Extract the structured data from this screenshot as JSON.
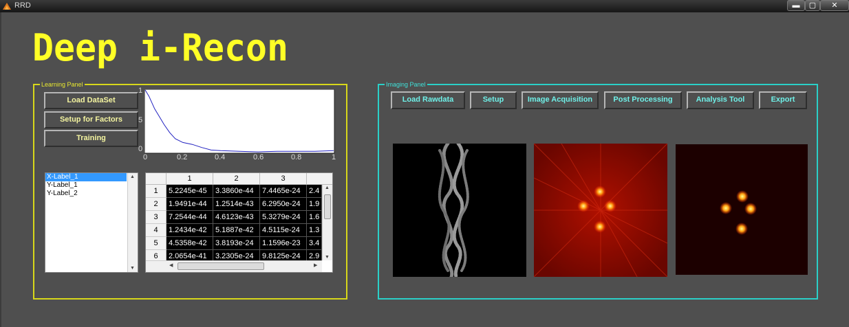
{
  "window": {
    "title": "RRD",
    "controls": [
      "▬",
      "▢",
      "✕"
    ]
  },
  "app_title": "Deep i-Recon",
  "colors": {
    "title_yellow": "#ffff26",
    "learning_border": "#d8d81a",
    "imaging_border": "#2ad0c8",
    "background": "#4f4f4f",
    "plot_line": "#2020c0"
  },
  "learning_panel": {
    "legend": "Learning Panel",
    "buttons": {
      "load_dataset": "Load DataSet",
      "setup_factors": "Setup for Factors",
      "training": "Training"
    },
    "plot": {
      "xticks": [
        "0",
        "0.2",
        "0.4",
        "0.6",
        "0.8",
        "1"
      ],
      "yticks": [
        "0",
        "5",
        "1"
      ],
      "xlim": [
        0,
        1
      ],
      "ylim": [
        0,
        1
      ],
      "series": [
        {
          "x": [
            0,
            0.02,
            0.05,
            0.08,
            0.1,
            0.13,
            0.16,
            0.2,
            0.25,
            0.3,
            0.35,
            0.4,
            0.5,
            0.6,
            0.7,
            0.8,
            0.9,
            1
          ],
          "y": [
            1,
            0.9,
            0.7,
            0.55,
            0.45,
            0.32,
            0.22,
            0.16,
            0.13,
            0.08,
            0.04,
            0.03,
            0.02,
            0.01,
            0.02,
            0.02,
            0.02,
            0.03
          ]
        }
      ]
    },
    "listbox": {
      "items": [
        "X-Label_1",
        "Y-Label_1",
        "Y-Label_2"
      ],
      "selected": 0
    },
    "table": {
      "columns": [
        "1",
        "2",
        "3"
      ],
      "rows": [
        {
          "label": "1",
          "cells": [
            "5.2245e-45",
            "3.3860e-44",
            "7.4465e-24",
            "2.4"
          ]
        },
        {
          "label": "2",
          "cells": [
            "1.9491e-44",
            "1.2514e-43",
            "6.2950e-24",
            "1.9"
          ]
        },
        {
          "label": "3",
          "cells": [
            "7.2544e-44",
            "4.6123e-43",
            "5.3279e-24",
            "1.6"
          ]
        },
        {
          "label": "4",
          "cells": [
            "1.2434e-42",
            "5.1887e-42",
            "4.5115e-24",
            "1.3"
          ]
        },
        {
          "label": "5",
          "cells": [
            "4.5358e-42",
            "3.8193e-24",
            "1.1596e-23",
            "3.4"
          ]
        },
        {
          "label": "6",
          "cells": [
            "2.0654e-41",
            "3.2305e-24",
            "9.8125e-24",
            "2.9"
          ]
        }
      ]
    }
  },
  "imaging_panel": {
    "legend": "Imaging Panel",
    "buttons": {
      "load_rawdata": "Load Rawdata",
      "setup": "Setup",
      "image_acquisition": "Image Acquisition",
      "post_processing": "Post Processing",
      "analysis_tool": "Analysis Tool",
      "export": "Export"
    }
  }
}
